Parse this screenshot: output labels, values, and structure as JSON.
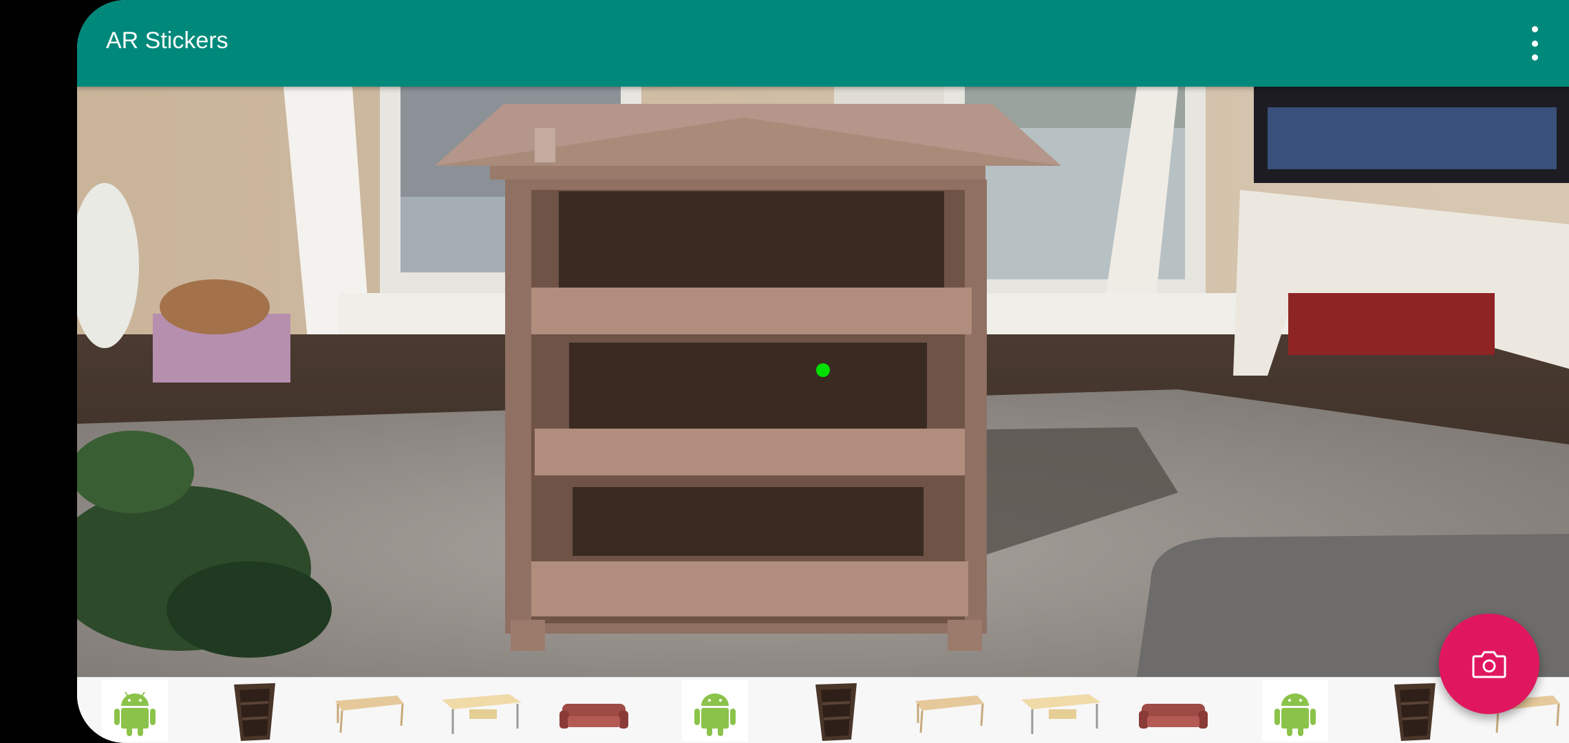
{
  "app": {
    "title": "AR Stickers",
    "toolbar_color": "#00897B",
    "accent_color": "#E0175F",
    "overflow_icon": "more-vert-icon"
  },
  "camera_view": {
    "placed_model": "bookshelf",
    "tracking_point_color": "#00E000"
  },
  "fab": {
    "icon": "camera-icon"
  },
  "gallery": {
    "items": [
      {
        "model": "android"
      },
      {
        "model": "bookshelf"
      },
      {
        "model": "table"
      },
      {
        "model": "desk"
      },
      {
        "model": "sofa"
      },
      {
        "model": "android"
      },
      {
        "model": "bookshelf"
      },
      {
        "model": "table"
      },
      {
        "model": "desk"
      },
      {
        "model": "sofa"
      },
      {
        "model": "android"
      },
      {
        "model": "bookshelf"
      },
      {
        "model": "table"
      }
    ]
  }
}
